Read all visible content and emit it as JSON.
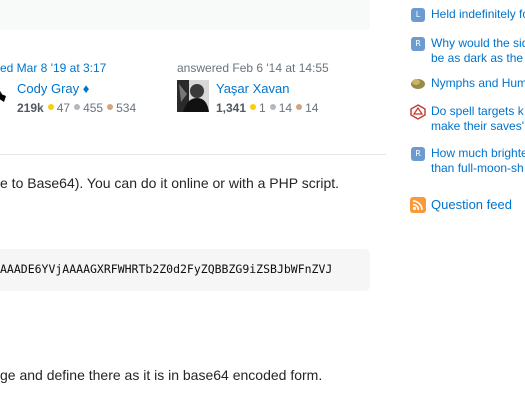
{
  "edit_info": {
    "label": "ed Mar 8 '19 at 3:17"
  },
  "editor": {
    "name": "Cody Gray ♦",
    "rep": "219k",
    "gold": "47",
    "silver": "455",
    "bronze": "534"
  },
  "answer_info": {
    "label": "answered Feb 6 '14 at 14:55"
  },
  "answerer": {
    "name": "Yaşar Xavan",
    "rep": "1,341",
    "gold": "1",
    "silver": "14",
    "bronze": "14"
  },
  "post": {
    "line1": "e to Base64). You can do it online or with a PHP script.",
    "code": "AAADE6YVjAAAAGXRFWHRTb2Z0d2FyZQBBZG9iZSBJbWFnZVJ",
    "line2": "ge and define there as it is in base64 encoded form."
  },
  "sidebar": {
    "items": [
      {
        "icon": "rpg-icon",
        "lines": [
          "Held indefinitely fo"
        ]
      },
      {
        "icon": "rpg-icon",
        "lines": [
          "Why would the sid",
          "be as dark as the"
        ]
      },
      {
        "icon": "bird-icon",
        "lines": [
          "Nymphs and Hum"
        ]
      },
      {
        "icon": "d20-icon",
        "lines": [
          "Do spell targets k",
          "make their saves'"
        ]
      },
      {
        "icon": "rpg-icon",
        "lines": [
          "How much brighte",
          "than full-moon-sh"
        ]
      }
    ],
    "feed_label": "Question feed"
  },
  "colors": {
    "link": "#0074cc",
    "gold": "#ffcc01",
    "silver": "#b4b8bc",
    "bronze": "#d1a684",
    "feed": "#f99a3a"
  }
}
